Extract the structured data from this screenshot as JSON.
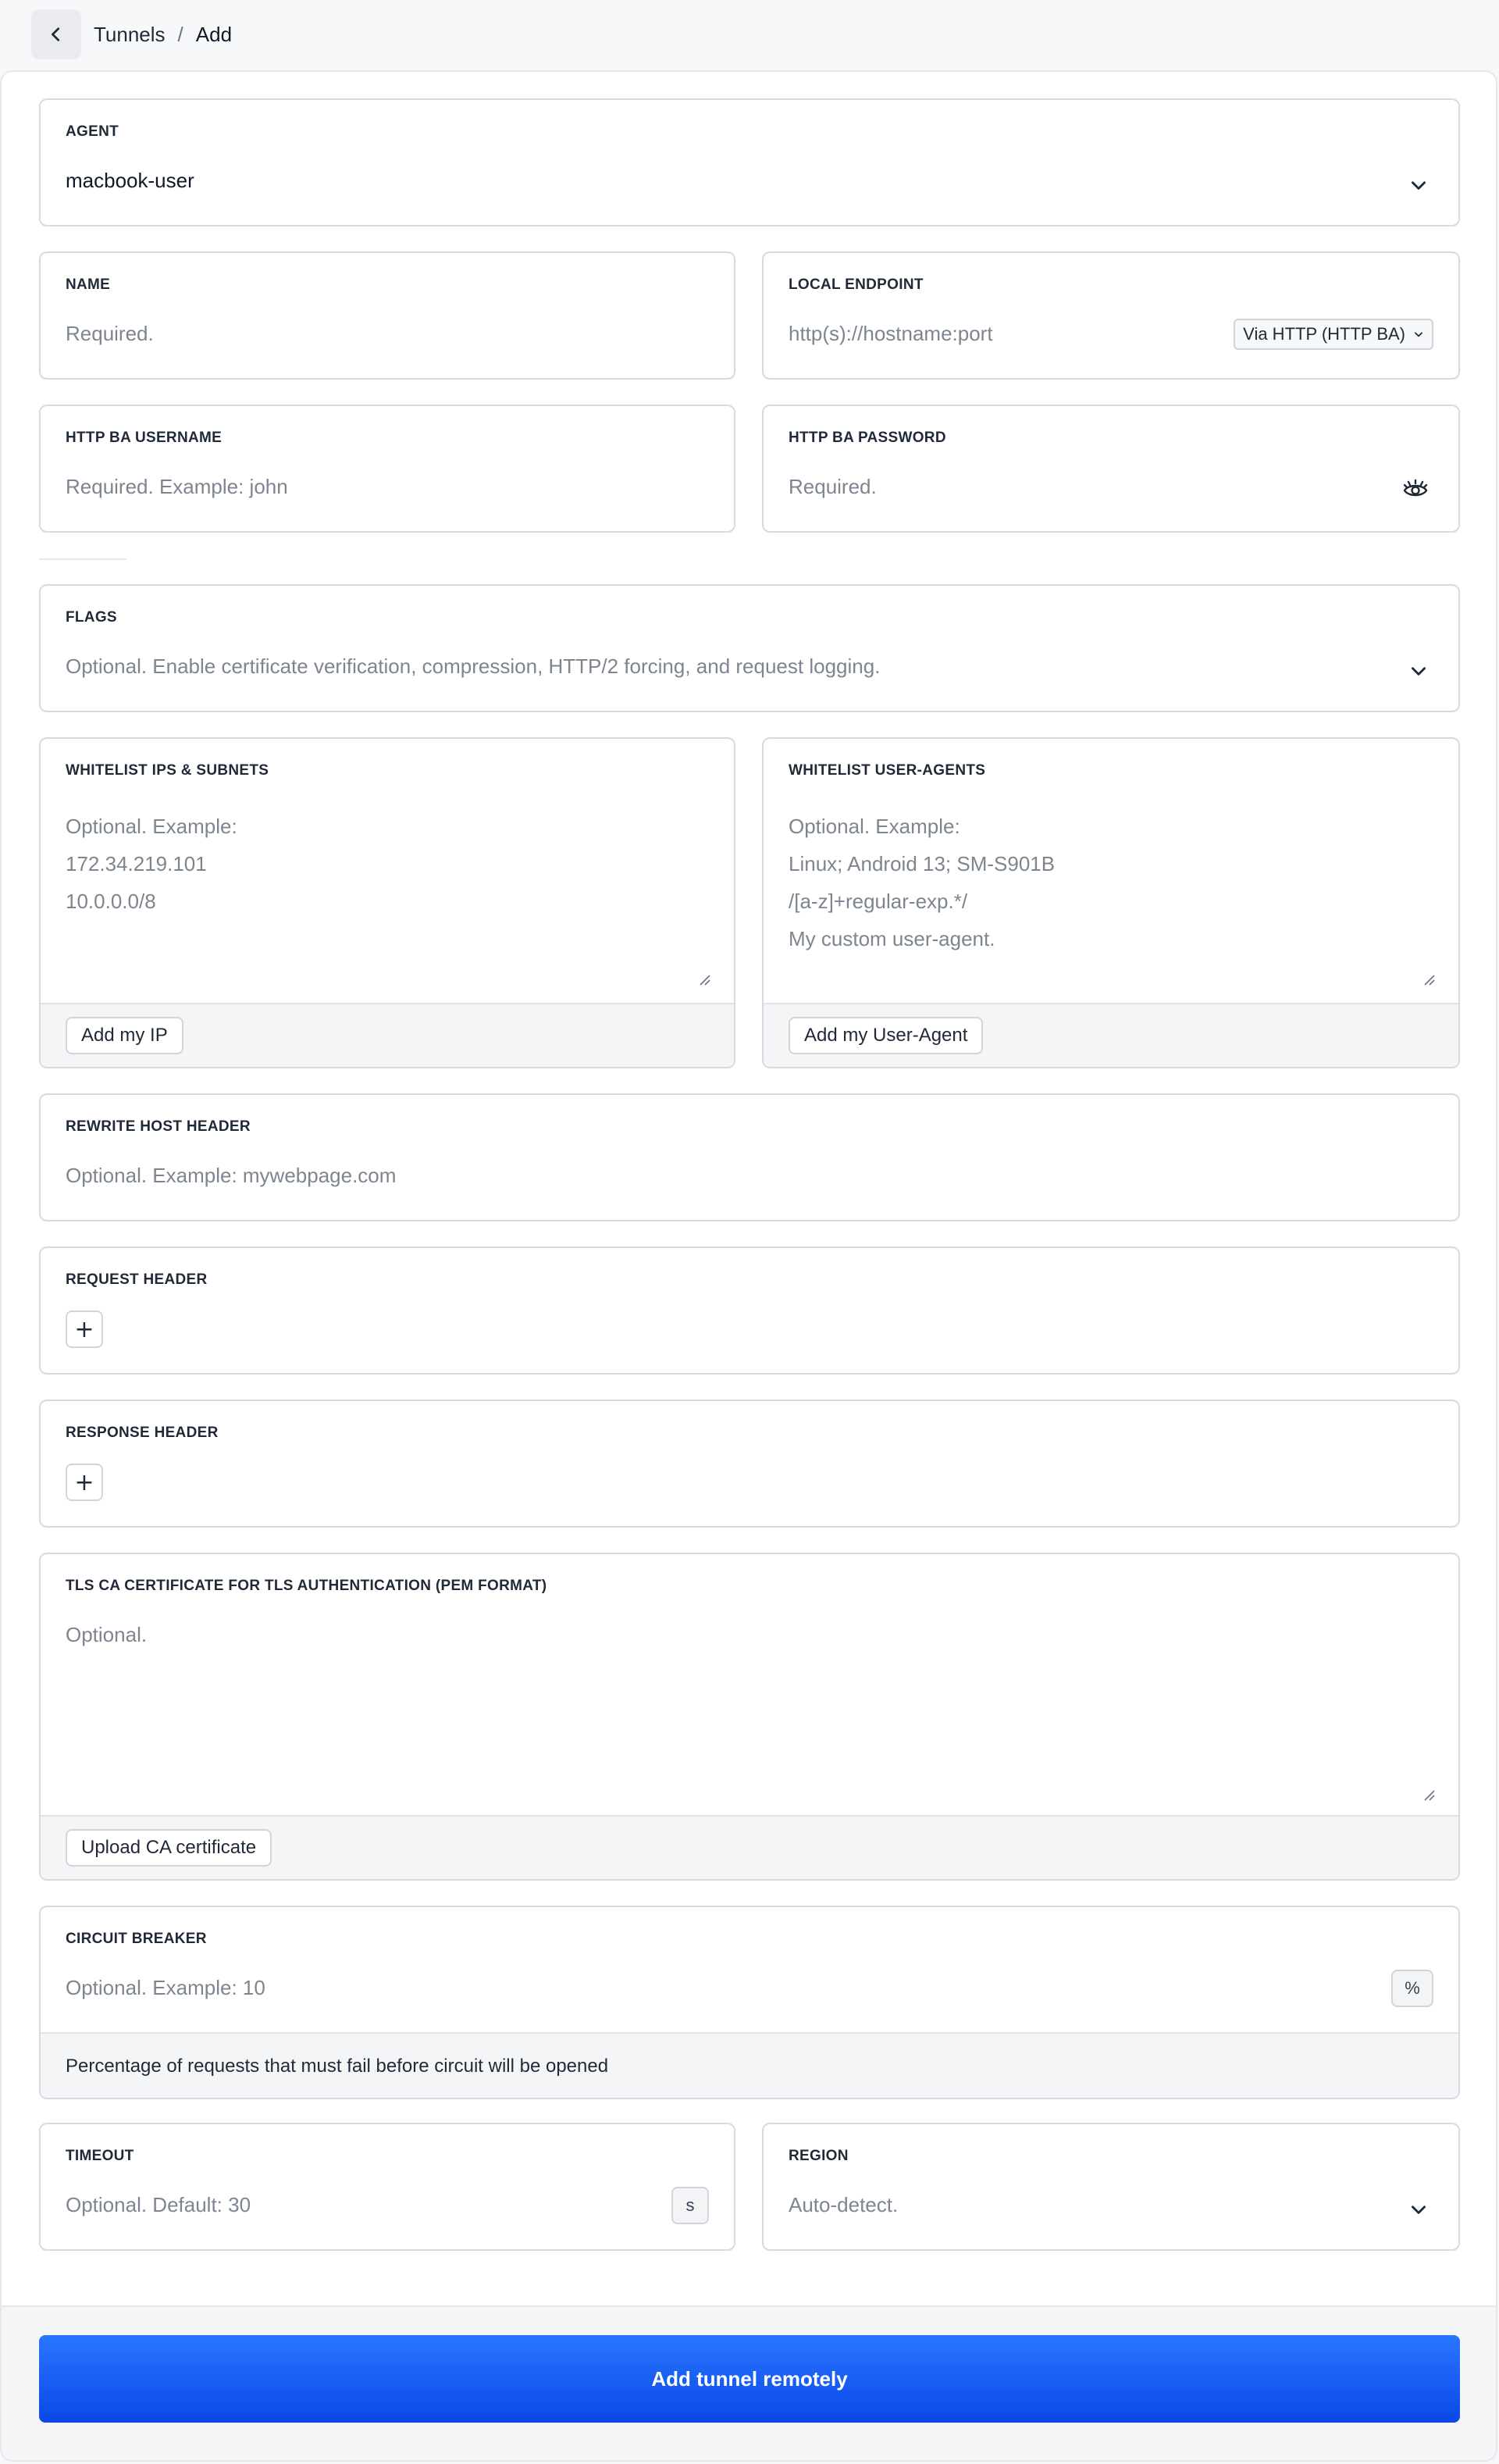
{
  "breadcrumb": {
    "parent": "Tunnels",
    "separator": "/",
    "current": "Add"
  },
  "agent": {
    "label": "AGENT",
    "value": "macbook-user"
  },
  "name": {
    "label": "NAME",
    "placeholder": "Required."
  },
  "local_endpoint": {
    "label": "LOCAL ENDPOINT",
    "placeholder": "http(s)://hostname:port",
    "mode": "Via HTTP (HTTP BA)"
  },
  "ba_username": {
    "label": "HTTP BA USERNAME",
    "placeholder": "Required. Example: john"
  },
  "ba_password": {
    "label": "HTTP BA PASSWORD",
    "placeholder": "Required."
  },
  "flags": {
    "label": "FLAGS",
    "placeholder": "Optional. Enable certificate verification, compression, HTTP/2 forcing, and request logging."
  },
  "whitelist_ips": {
    "label": "WHITELIST IPS & SUBNETS",
    "lines": [
      "Optional. Example:",
      "172.34.219.101",
      "10.0.0.0/8"
    ],
    "button": "Add my IP"
  },
  "whitelist_agents": {
    "label": "WHITELIST USER-AGENTS",
    "lines": [
      "Optional. Example:",
      "Linux; Android 13; SM-S901B",
      "/[a-z]+regular-exp.*/",
      "My custom user-agent."
    ],
    "button": "Add my User-Agent"
  },
  "rewrite_host": {
    "label": "REWRITE HOST HEADER",
    "placeholder": "Optional. Example: mywebpage.com"
  },
  "request_header": {
    "label": "REQUEST HEADER",
    "add": "+"
  },
  "response_header": {
    "label": "RESPONSE HEADER",
    "add": "+"
  },
  "tls_ca": {
    "label": "TLS CA CERTIFICATE FOR TLS AUTHENTICATION (PEM FORMAT)",
    "placeholder": "Optional.",
    "button": "Upload CA certificate"
  },
  "circuit_breaker": {
    "label": "CIRCUIT BREAKER",
    "placeholder": "Optional. Example: 10",
    "suffix": "%",
    "hint": "Percentage of requests that must fail before circuit will be opened"
  },
  "timeout": {
    "label": "TIMEOUT",
    "placeholder": "Optional. Default: 30",
    "suffix": "s"
  },
  "region": {
    "label": "REGION",
    "placeholder": "Auto-detect."
  },
  "submit": {
    "label": "Add tunnel remotely"
  },
  "colors": {
    "accent": "#0a48e6",
    "border": "#d7dbe0",
    "placeholder": "#7d8590"
  }
}
